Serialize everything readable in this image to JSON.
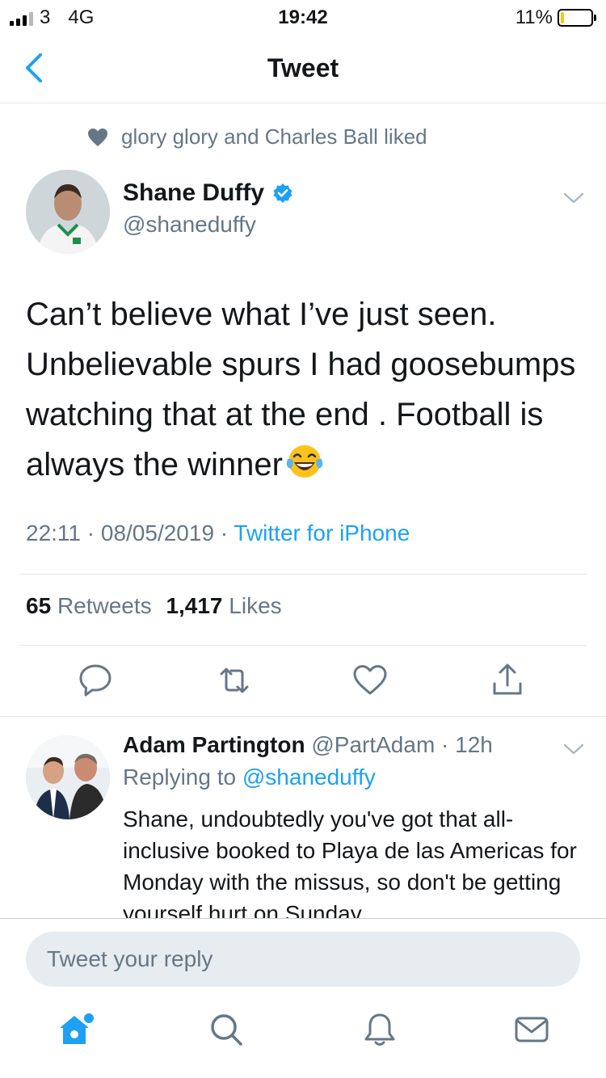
{
  "status_bar": {
    "carrier": "3",
    "network": "4G",
    "time": "19:42",
    "battery": "11%",
    "battery_level": 0.11
  },
  "nav": {
    "title": "Tweet"
  },
  "social_context": {
    "text": "glory glory and Charles Ball liked"
  },
  "tweet": {
    "author_name": "Shane Duffy",
    "author_handle": "@shaneduffy",
    "verified": true,
    "text_lines": [
      "Can’t believe what I’ve just seen.",
      "Unbelievable spurs I had goosebumps",
      "watching that at the end . Football is",
      "always the winner"
    ],
    "timestamp": "22:11 · 08/05/2019 · ",
    "source": "Twitter for iPhone",
    "retweets_count": "65",
    "retweets_label": "Retweets",
    "likes_count": "1,417",
    "likes_label": "Likes"
  },
  "reply": {
    "author_name": "Adam Partington",
    "author_handle": "@PartAdam",
    "time": "· 12h",
    "replying_prefix": "Replying to ",
    "replying_to": "@shaneduffy",
    "text": "Shane, undoubtedly you've got that all-inclusive booked to Playa de las Americas for Monday with the missus, so don't be getting yourself hurt on Sunday"
  },
  "compose": {
    "placeholder": "Tweet your reply"
  },
  "colors": {
    "accent": "#1da1f2",
    "secondary_text": "#657786",
    "primary_text": "#14171a",
    "divider": "#e1e8ed"
  },
  "icons": {
    "back": "chevron-left-icon",
    "like_context": "heart-filled-icon",
    "verified": "verified-badge-icon",
    "more": "chevron-down-icon",
    "reply": "reply-icon",
    "retweet": "retweet-icon",
    "like": "heart-icon",
    "share": "share-icon",
    "home": "home-icon",
    "search": "search-icon",
    "notifications": "bell-icon",
    "messages": "envelope-icon"
  }
}
